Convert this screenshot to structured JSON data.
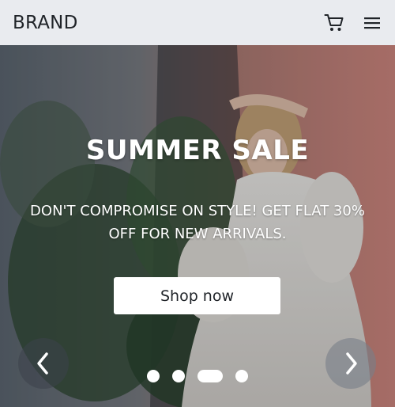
{
  "navbar": {
    "brand": "BRAND",
    "icons": [
      "cart-icon",
      "menu-icon"
    ]
  },
  "hero": {
    "title": "SUMMER SALE",
    "subtitle": "DON'T COMPROMISE ON STYLE! GET FLAT 30% OFF FOR NEW ARRIVALS.",
    "cta_label": "Shop now",
    "carousel": {
      "slide_count": 4,
      "active_index": 2,
      "prev_icon": "chevron-left-icon",
      "next_icon": "chevron-right-icon"
    }
  },
  "colors": {
    "navbar_bg": "#e9ebef",
    "text_dark": "#1f2328",
    "white": "#ffffff"
  }
}
